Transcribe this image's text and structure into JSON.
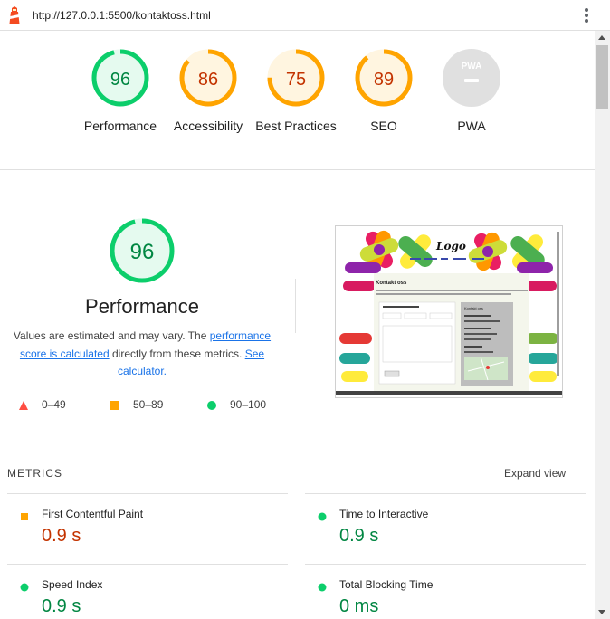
{
  "header": {
    "url": "http://127.0.0.1:5500/kontaktoss.html"
  },
  "colors": {
    "pass": "#0cce6b",
    "pass_text": "#018642",
    "average": "#ffa400",
    "average_text": "#c33300",
    "fail": "#ff4e42",
    "na": "#757575"
  },
  "categories": [
    {
      "label": "Performance",
      "score": "96",
      "level": "pass"
    },
    {
      "label": "Accessibility",
      "score": "86",
      "level": "average"
    },
    {
      "label": "Best Practices",
      "score": "75",
      "level": "average"
    },
    {
      "label": "SEO",
      "score": "89",
      "level": "average"
    },
    {
      "label": "PWA",
      "score": "",
      "level": "na"
    }
  ],
  "summary": {
    "score": "96",
    "title": "Performance",
    "desc_1": "Values are estimated and may vary. The ",
    "desc_link_1": "performance score is calculated",
    "desc_2": " directly from these metrics. ",
    "desc_link_2": "See calculator."
  },
  "legend": [
    {
      "range": "0–49",
      "icon": "triangle-icon"
    },
    {
      "range": "50–89",
      "icon": "square-icon"
    },
    {
      "range": "90–100",
      "icon": "circle-icon"
    }
  ],
  "metrics": {
    "title": "METRICS",
    "expand_label": "Expand view",
    "items": [
      {
        "name": "First Contentful Paint",
        "value": "0.9 s",
        "level": "average"
      },
      {
        "name": "Time to Interactive",
        "value": "0.9 s",
        "level": "pass"
      },
      {
        "name": "Speed Index",
        "value": "0.9 s",
        "level": "pass"
      },
      {
        "name": "Total Blocking Time",
        "value": "0 ms",
        "level": "pass"
      }
    ]
  },
  "screenshot": {
    "logo_text": "Logo",
    "heading": "Kontakt oss",
    "sidebar_title": "Kontakt oss"
  },
  "pwa_badge_text": "PWA"
}
